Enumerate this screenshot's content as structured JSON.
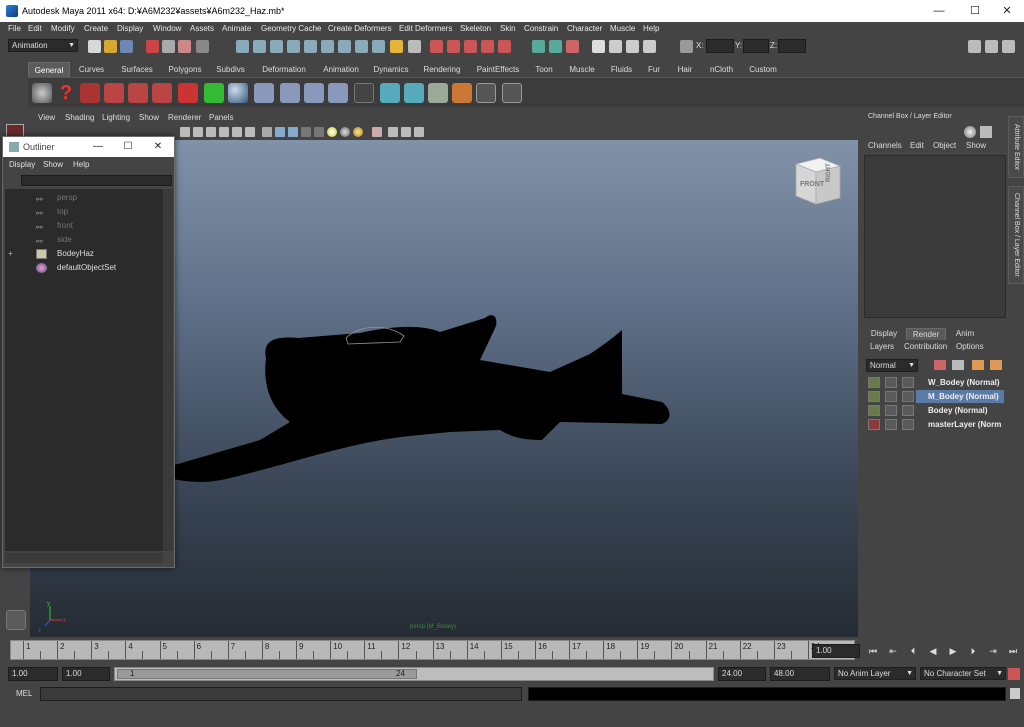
{
  "window": {
    "title": "Autodesk Maya 2011 x64: D:¥A6M232¥assets¥A6m232_Haz.mb*",
    "minimize": "—",
    "maximize": "☐",
    "close": "✕"
  },
  "menubar": [
    "File",
    "Edit",
    "Modify",
    "Create",
    "Display",
    "Window",
    "Assets",
    "Animate",
    "Geometry Cache",
    "Create Deformers",
    "Edit Deformers",
    "Skeleton",
    "Skin",
    "Constrain",
    "Character",
    "Muscle",
    "Help"
  ],
  "statusline": {
    "menuset": "Animation",
    "x_label": "X:",
    "y_label": "Y:",
    "z_label": "Z:"
  },
  "shelf_tabs": [
    "General",
    "Curves",
    "Surfaces",
    "Polygons",
    "Subdivs",
    "Deformation",
    "Animation",
    "Dynamics",
    "Rendering",
    "PaintEffects",
    "Toon",
    "Muscle",
    "Fluids",
    "Fur",
    "Hair",
    "nCloth",
    "Custom"
  ],
  "shelf_active": "General",
  "panel_menu": [
    "View",
    "Shading",
    "Lighting",
    "Show",
    "Renderer",
    "Panels"
  ],
  "viewport": {
    "camera_label": "persp (M_Bodey)",
    "viewcube_front": "FRONT",
    "viewcube_side": "RIGHT",
    "axis_x": "x",
    "axis_y": "y",
    "axis_z": "z"
  },
  "channel_box": {
    "header": "Channel Box / Layer Editor",
    "menu": [
      "Channels",
      "Edit",
      "Object",
      "Show"
    ],
    "side_tabs": [
      "Attribute Editor",
      "Channel Box / Layer Editor"
    ]
  },
  "layer_editor": {
    "tabs": [
      "Display",
      "Render",
      "Anim"
    ],
    "active_tab": "Render",
    "submenu": [
      "Layers",
      "Contribution",
      "Options"
    ],
    "mode": "Normal",
    "layers": [
      {
        "name": "W_Bodey (Normal)",
        "selected": false
      },
      {
        "name": "M_Bodey (Normal)",
        "selected": true
      },
      {
        "name": "Bodey (Normal)",
        "selected": false
      },
      {
        "name": "masterLayer (Norm",
        "selected": false
      }
    ]
  },
  "timeline": {
    "ticks": [
      "1",
      "2",
      "3",
      "4",
      "5",
      "6",
      "7",
      "8",
      "9",
      "10",
      "11",
      "12",
      "13",
      "14",
      "15",
      "16",
      "17",
      "18",
      "19",
      "20",
      "21",
      "22",
      "23",
      "24"
    ],
    "current_frame": "1.00"
  },
  "range": {
    "start": "1.00",
    "playback_start": "1.00",
    "range_start": "1",
    "range_end": "24",
    "playback_end": "24.00",
    "end": "48.00",
    "anim_layer": "No Anim Layer",
    "character_set": "No Character Set"
  },
  "mel": {
    "label": "MEL"
  },
  "outliner": {
    "title": "Outliner",
    "menu": [
      "Display",
      "Show",
      "Help"
    ],
    "items": [
      {
        "label": "persp",
        "dim": true
      },
      {
        "label": "top",
        "dim": true
      },
      {
        "label": "front",
        "dim": true
      },
      {
        "label": "side",
        "dim": true
      },
      {
        "label": "BodeyHaz",
        "dim": false
      },
      {
        "label": "defaultObjectSet",
        "dim": false
      }
    ],
    "expand_symbol": "+"
  },
  "colors": {
    "accent": "#5a7aa8",
    "selected_layer": "#5a7aa8",
    "viewport_top": "#8192a8",
    "viewport_bottom": "#252b33",
    "silhouette": "#000000"
  }
}
